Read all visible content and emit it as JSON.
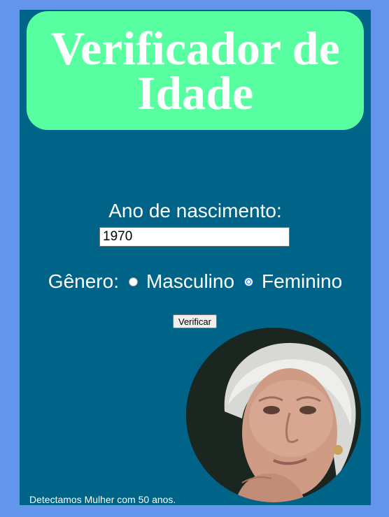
{
  "header": {
    "title": "Verificador de Idade",
    "background_color": "#58FFA0"
  },
  "form": {
    "year_label": "Ano de nascimento:",
    "year_value": "1970",
    "gender_label": "Gênero:",
    "gender_options": [
      "Masculino",
      "Feminino"
    ],
    "gender_selected": "Feminino",
    "submit_label": "Verificar"
  },
  "result": {
    "text": "Detectamos Mulher com 50 anos.",
    "image_icon": "elderly-woman-photo"
  },
  "colors": {
    "page_background": "#6495ED",
    "panel_background": "#006388",
    "text": "#FFFFFF"
  }
}
